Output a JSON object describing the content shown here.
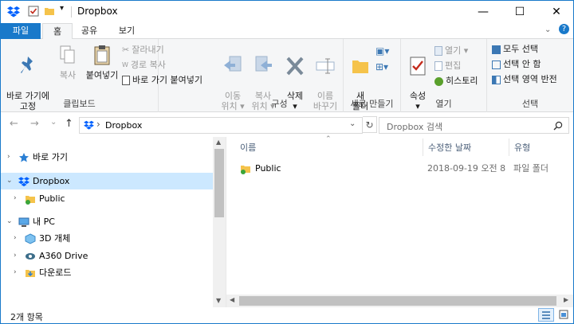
{
  "window": {
    "title": "Dropbox"
  },
  "titlebar": {
    "minimize": "—",
    "maximize": "☐",
    "close": "✕",
    "qat_dropdown": "▾"
  },
  "tabs": [
    "파일",
    "홈",
    "공유",
    "보기"
  ],
  "ribbon": {
    "pin": "바로 가기에\n고정",
    "copy": "복사",
    "paste": "붙여넣기",
    "cut": "잘라내기",
    "copy_path": "경로 복사",
    "paste_shortcut": "바로 가기 붙여넣기",
    "group_clipboard": "클립보드",
    "move_to": "이동\n위치 ▾",
    "copy_to": "복사\n위치 ▾",
    "delete": "삭제\n▾",
    "rename": "이름\n바꾸기",
    "group_organize": "구성",
    "new_folder": "새\n폴더",
    "group_new": "새로 만들기",
    "properties": "속성\n▾",
    "open": "열기 ▾",
    "edit": "편집",
    "history": "히스토리",
    "group_open": "열기",
    "select_all": "모두 선택",
    "select_none": "선택 안 함",
    "invert_selection": "선택 영역 반전",
    "group_select": "선택"
  },
  "nav": {
    "back": "←",
    "forward": "→",
    "recent": "⌄",
    "up": "↑",
    "address": "Dropbox",
    "address_sep": "›",
    "address_dropdown": "⌄",
    "refresh": "↻",
    "search_placeholder": "Dropbox 검색"
  },
  "tree": [
    {
      "label": "바로 가기",
      "chev": "›"
    },
    {
      "label": "Dropbox",
      "chev": "⌄"
    },
    {
      "label": "Public",
      "chev": "›"
    },
    {
      "label": "내 PC",
      "chev": "⌄"
    },
    {
      "label": "3D 개체",
      "chev": "›"
    },
    {
      "label": "A360 Drive",
      "chev": "›"
    },
    {
      "label": "다운로드",
      "chev": "›"
    }
  ],
  "columns": {
    "name": "이름",
    "modified": "수정한 날짜",
    "type": "유형",
    "sort_arrow": "⌃"
  },
  "files": [
    {
      "name": "Public",
      "modified": "2018-09-19 오전 8",
      "type": "파일 폴더"
    }
  ],
  "status": {
    "count": "2개 항목"
  },
  "colors": {
    "accent": "#1979ca",
    "selection": "#cce8ff",
    "ribbon_bg": "#f5f6f7",
    "dropbox_blue": "#0061fe"
  }
}
